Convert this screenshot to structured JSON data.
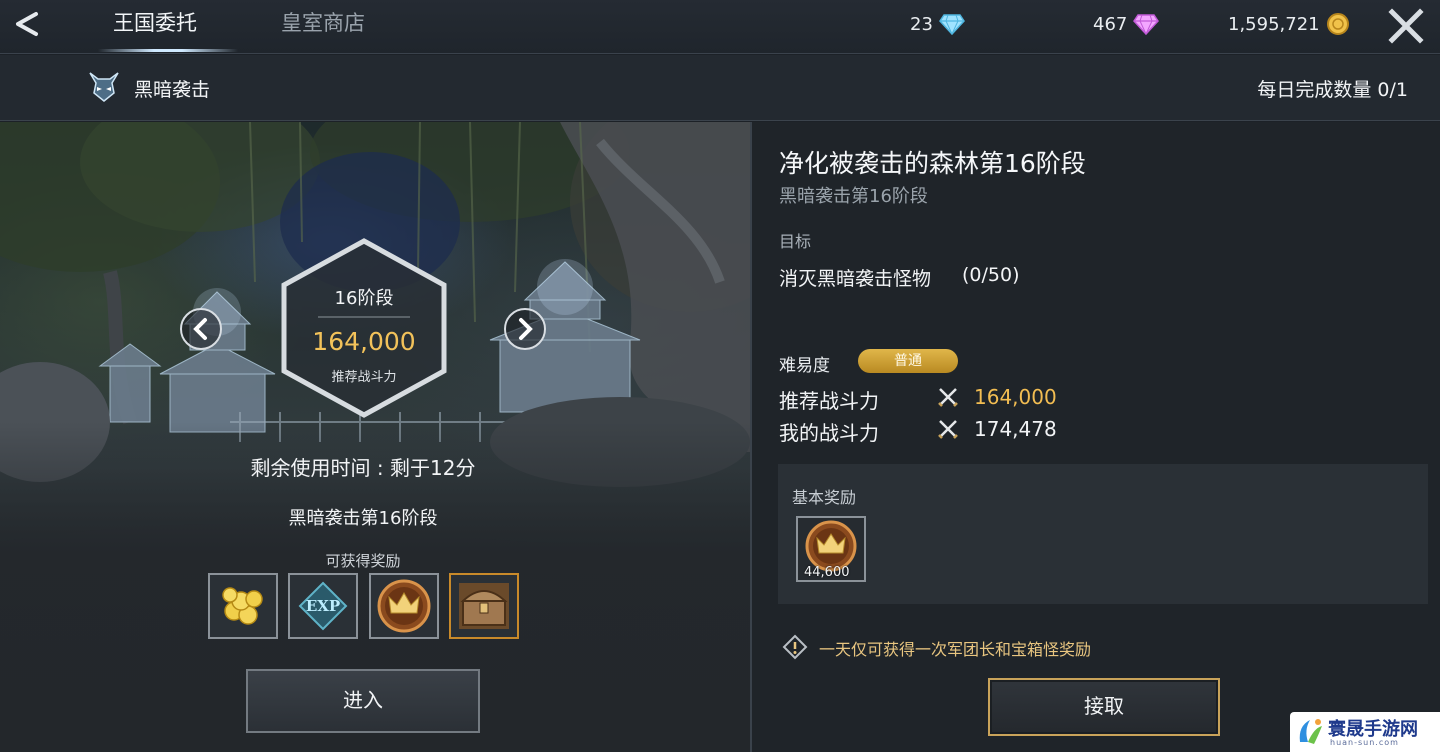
{
  "topbar": {
    "tabs": [
      {
        "label": "王国委托",
        "active": true
      },
      {
        "label": "皇室商店",
        "active": false
      }
    ],
    "currencies": [
      {
        "value": "23",
        "icon": "blue-diamond-icon"
      },
      {
        "value": "467",
        "icon": "pink-diamond-icon"
      },
      {
        "value": "1,595,721",
        "icon": "gold-coin-icon"
      }
    ]
  },
  "subheader": {
    "mode_title": "黑暗袭击",
    "daily_count": "每日完成数量 0/1"
  },
  "scene": {
    "stage": "16阶段",
    "recommended_power": "164,000",
    "recommended_label": "推荐战斗力",
    "time_left": "剩余使用时间 : 剩于12分",
    "stage_name": "黑暗袭击第16阶段",
    "rewards_label": "可获得奖励",
    "rewards": [
      {
        "icon": "gold-coins-icon"
      },
      {
        "icon": "exp-icon",
        "label": "EXP"
      },
      {
        "icon": "crown-medal-icon"
      },
      {
        "icon": "treasure-chest-icon"
      }
    ],
    "enter_label": "进入"
  },
  "panel": {
    "title": "净化被袭击的森林第16阶段",
    "subtitle": "黑暗袭击第16阶段",
    "objective_label": "目标",
    "objective_text": "消灭黑暗袭击怪物",
    "objective_progress": "(0/50)",
    "difficulty_label": "难易度",
    "difficulty_value": "普通",
    "recommended_power_label": "推荐战斗力",
    "recommended_power_value": "164,000",
    "my_power_label": "我的战斗力",
    "my_power_value": "174,478",
    "basic_reward_label": "基本奖励",
    "basic_reward_qty": "44,600",
    "notice": "一天仅可获得一次军团长和宝箱怪奖励",
    "claim_label": "接取"
  },
  "watermark": {
    "text": "寰晟手游网",
    "url": "huan-sun.com"
  },
  "colors": {
    "accent_gold": "#f2bd52",
    "difficulty_badge": "#d4a63a",
    "claim_border": "#c9a35a"
  }
}
